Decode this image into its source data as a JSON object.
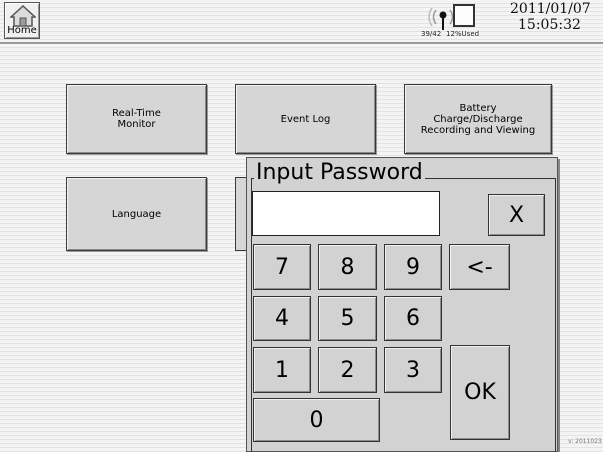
{
  "header": {
    "home_label": "Home",
    "signal_text": "39/42",
    "storage_text": "12%Used",
    "date": "2011/01/07",
    "time": "15:05:32"
  },
  "menu": {
    "realtime": "Real-Time Monitor",
    "eventlog": "Event Log",
    "battery": "Battery Charge/Discharge Recording and Viewing",
    "language": "Language"
  },
  "dialog": {
    "title": "Input Password",
    "password_value": "",
    "keys": {
      "close": "X",
      "k7": "7",
      "k8": "8",
      "k9": "9",
      "backspace": "<-",
      "k4": "4",
      "k5": "5",
      "k6": "6",
      "k1": "1",
      "k2": "2",
      "k3": "3",
      "ok": "OK",
      "k0": "0"
    }
  },
  "footer": {
    "version": "v: 2011023"
  },
  "icons": {
    "home": "home-icon",
    "signal": "signal-antenna-icon",
    "storage": "storage-icon"
  },
  "colors": {
    "dialog_bg": "#d2d2d2",
    "button_bg": "#d6d6d6",
    "field_bg": "#ffffff"
  }
}
